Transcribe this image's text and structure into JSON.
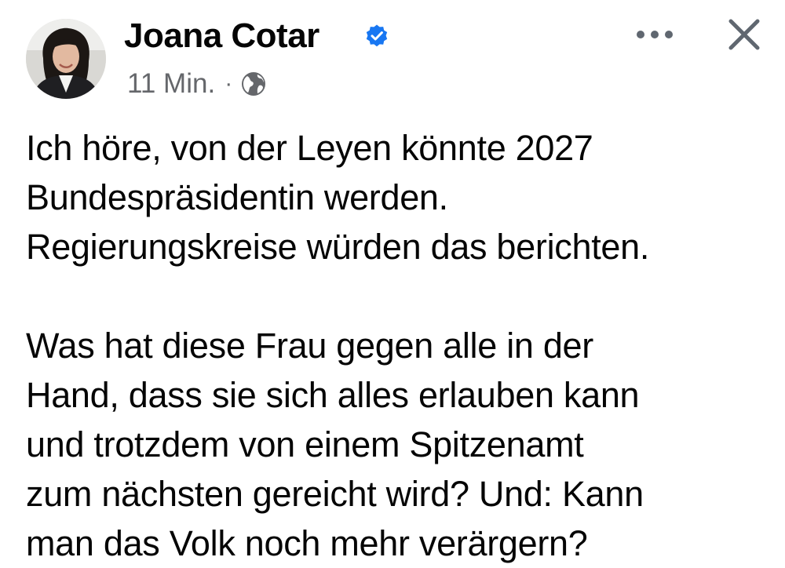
{
  "post": {
    "author": {
      "name": "Joana Cotar",
      "verified": true
    },
    "meta": {
      "time": "11 Min.",
      "separator": "·",
      "audience_icon": "globe-icon"
    },
    "actions": {
      "more_icon": "more-horizontal-icon",
      "close_icon": "close-icon"
    },
    "paragraphs": [
      "Ich höre, von der Leyen könnte 2027\nBundespräsidentin werden.\nRegierungskreise würden das berichten.",
      "Was hat diese Frau gegen alle in der\nHand, dass sie sich alles erlauben kann\nund trotzdem von einem Spitzenamt\nzum nächsten gereicht wird? Und: Kann\nman das Volk noch mehr verärgern?"
    ]
  },
  "colors": {
    "text": "#050505",
    "secondary_text": "#65676b",
    "verified_blue": "#1877f2",
    "icon_gray": "#606770"
  }
}
